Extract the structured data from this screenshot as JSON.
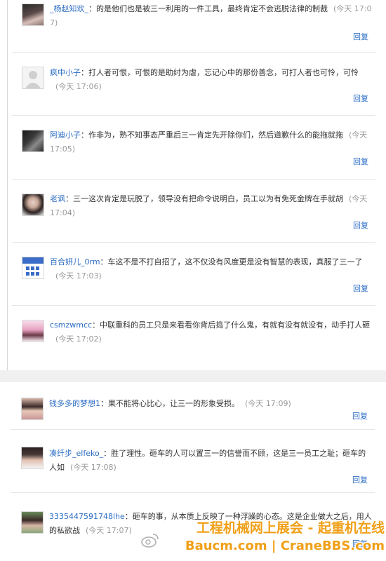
{
  "comments_top": [
    {
      "user": "_杨赵知欢_",
      "text": "的是他们也是被三一利用的一件工具，最终肯定不会逃脱法律的制裁",
      "time": "(今天 17:07)",
      "reply": "回复",
      "avatar": "avatar-dark-hair"
    },
    {
      "user": "疯中小子",
      "text": "打人者可恨，可恨的是助纣为虐，忘记心中的那份善念，可打人者也可怜，可怜",
      "time": "(今天 17:06)",
      "reply": "回复",
      "avatar": "avatar-default-silhouette"
    },
    {
      "user": "阿迪小子",
      "text": "作非为，熟不知事态严重后三一肯定先开除你们，然后道歉什么的能拖就拖",
      "time": "(今天 17:05)",
      "reply": "回复",
      "avatar": "avatar-portrait"
    },
    {
      "user": "老讽",
      "text": "三一这次肯定是玩脱了，领导没有把命令说明白，员工以为有免死金牌在手就胡",
      "time": "(今天 17:04)",
      "reply": "回复",
      "avatar": "avatar-portrait-woman"
    },
    {
      "user": "百合妍儿_0rm",
      "text": "车这不是不打自招了，这不仅没有风度更是没有智慧的表现，真服了三一了",
      "time": "(今天 17:03)",
      "reply": "回复",
      "avatar": "avatar-blue-calendar"
    },
    {
      "user": "csmzwmcc",
      "text": "中联重科的员工只是来看看你背后捣了什么鬼，有就有没有就没有，动手打人砸",
      "time": "(今天 17:02)",
      "reply": "回复",
      "avatar": "avatar-girl-pink"
    }
  ],
  "comments_bottom": [
    {
      "user": "钱多多的梦想1",
      "text": "果不能将心比心，让三一的形象受损。",
      "time": "(今天 17:09)",
      "reply": "回复",
      "avatar": "avatar-girl-portrait"
    },
    {
      "user": "凑纤步_elfeko_",
      "text": "胜了理性。砸车的人可以置三一的信誉而不顾，这是三一员工之耻；砸车的人如",
      "time": "(今天 17:08)",
      "reply": "回复",
      "avatar": "avatar-girl-dark"
    },
    {
      "user": "3335447591748lhe",
      "text": "砸车的事，从本质上反映了一种浮躁的心态。这是企业做大之后，用人的私欲战",
      "time": "(今天 17:07)",
      "reply": "回复",
      "avatar": "avatar-girl-green"
    }
  ],
  "watermark": {
    "line1": "工程机械网上展会 - 起重机在线",
    "line2": "Baucm.com | CraneBBS.com"
  },
  "colors": {
    "link": "#2b6cc4",
    "time": "#999999",
    "watermark": "#f0a018"
  }
}
